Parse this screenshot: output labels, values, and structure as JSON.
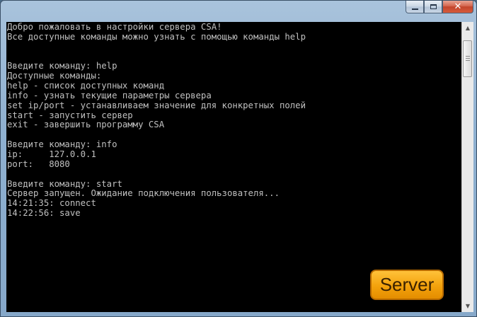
{
  "window": {
    "caption_buttons": {
      "minimize": "minimize-icon",
      "maximize": "maximize-icon",
      "close": "close-icon"
    }
  },
  "console": {
    "lines": [
      "Добро пожаловать в настройки сервера CSA!",
      "Все доступные команды можно узнать с помощью команды help",
      "",
      "",
      "Введите команду: help",
      "Доступные команды:",
      "help - список доступных команд",
      "info - узнать текущие параметры сервера",
      "set ip/port - устанавливаем значение для конкретных полей",
      "start - запустить сервер",
      "exit - завершить программу CSA",
      "",
      "Введите команду: info",
      "ip:     127.0.0.1",
      "port:   8080",
      "",
      "Введите команду: start",
      "Сервер запущен. Ожидание подключения пользователя...",
      "14:21:35: connect",
      "14:22:56: save"
    ]
  },
  "badge": {
    "label": "Server",
    "color": "#f3a20c"
  }
}
